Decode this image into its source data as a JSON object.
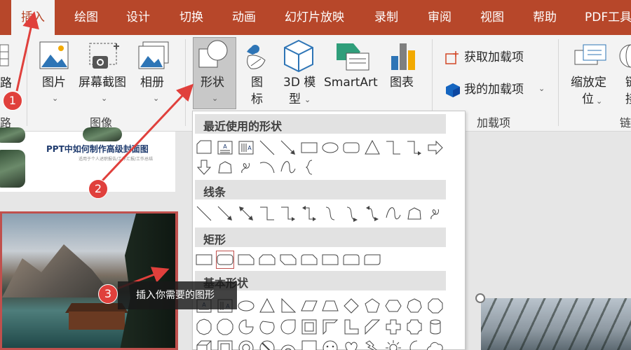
{
  "tabs": [
    "插入",
    "绘图",
    "设计",
    "切换",
    "动画",
    "幻灯片放映",
    "录制",
    "审阅",
    "视图",
    "帮助",
    "PDF工具"
  ],
  "ribbon": {
    "left_partial_label": "路",
    "left_partial_group": "路",
    "picture": "图片",
    "screenshot": "屏幕截图",
    "album": "相册",
    "images_group": "图像",
    "shapes": "形状",
    "icons_line1": "图",
    "icons_line2": "标",
    "model3d_line1": "3D 模",
    "model3d_line2": "型",
    "smartart": "SmartArt",
    "chart": "图表",
    "get_addins": "获取加载项",
    "my_addins": "我的加载项",
    "addins_group": "加载项",
    "zoom_line1": "缩放定",
    "zoom_line2": "位",
    "link_partial_1": "链",
    "link_partial_2": "接",
    "link_group_partial": "链"
  },
  "thumbnail": {
    "title": "PPT中如何制作高级封面图",
    "subtitle": "适用于个人述职报告/工作汇报/工作总结"
  },
  "dropdown": {
    "recent": "最近使用的形状",
    "lines": "线条",
    "rectangles": "矩形",
    "basic": "基本形状",
    "text_glyph_a": "A"
  },
  "annotations": {
    "badge1": "1",
    "badge2": "2",
    "badge3": "3",
    "tooltip": "插入你需要的图形"
  },
  "colors": {
    "accent": "#b7472a",
    "badge": "#e0403c"
  }
}
